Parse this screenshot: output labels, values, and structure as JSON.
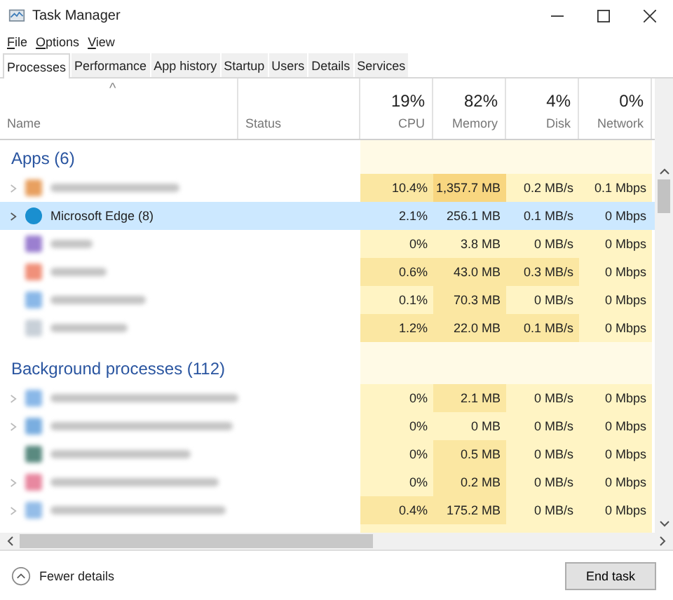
{
  "window": {
    "title": "Task Manager"
  },
  "menu": [
    "File",
    "Options",
    "View"
  ],
  "tabs": [
    {
      "label": "Processes",
      "selected": true
    },
    {
      "label": "Performance",
      "selected": false
    },
    {
      "label": "App history",
      "selected": false
    },
    {
      "label": "Startup",
      "selected": false
    },
    {
      "label": "Users",
      "selected": false
    },
    {
      "label": "Details",
      "selected": false
    },
    {
      "label": "Services",
      "selected": false
    }
  ],
  "table": {
    "sort_caret": "^",
    "columns": [
      {
        "label": "Name"
      },
      {
        "label": "Status"
      },
      {
        "label": "CPU",
        "total": "19%"
      },
      {
        "label": "Memory",
        "total": "82%"
      },
      {
        "label": "Disk",
        "total": "4%"
      },
      {
        "label": "Network",
        "total": "0%"
      }
    ],
    "groups": [
      {
        "title": "Apps (6)",
        "rows": [
          {
            "blurred": true,
            "expandable": true,
            "selected": false,
            "color": "#e8a060",
            "cells": [
              {
                "text": "10.4%",
                "color": "#fbe7a2"
              },
              {
                "text": "1,357.7 MB",
                "color": "#f8d680"
              },
              {
                "text": "0.2 MB/s",
                "color": "#fff4c4"
              },
              {
                "text": "0.1 Mbps",
                "color": "#fff4c4"
              }
            ]
          },
          {
            "blurred": false,
            "name": "Microsoft Edge (8)",
            "expandable": true,
            "selected": true,
            "color": "#1a8fd0",
            "cells": [
              {
                "text": "2.1%",
                "color": "#cce8ff"
              },
              {
                "text": "256.1 MB",
                "color": "#cce8ff"
              },
              {
                "text": "0.1 MB/s",
                "color": "#cce8ff"
              },
              {
                "text": "0 Mbps",
                "color": "#cce8ff"
              }
            ]
          },
          {
            "blurred": true,
            "expandable": false,
            "selected": false,
            "color": "#9b7fd0",
            "cells": [
              {
                "text": "0%",
                "color": "#fff4c4"
              },
              {
                "text": "3.8 MB",
                "color": "#fff4c4"
              },
              {
                "text": "0 MB/s",
                "color": "#fff4c4"
              },
              {
                "text": "0 Mbps",
                "color": "#fff4c4"
              }
            ]
          },
          {
            "blurred": true,
            "expandable": false,
            "selected": false,
            "color": "#f0907a",
            "cells": [
              {
                "text": "0.6%",
                "color": "#fbe7a2"
              },
              {
                "text": "43.0 MB",
                "color": "#fbe7a2"
              },
              {
                "text": "0.3 MB/s",
                "color": "#fbe7a2"
              },
              {
                "text": "0 Mbps",
                "color": "#fff4c4"
              }
            ]
          },
          {
            "blurred": true,
            "expandable": false,
            "selected": false,
            "color": "#8ab8e8",
            "cells": [
              {
                "text": "0.1%",
                "color": "#fff4c4"
              },
              {
                "text": "70.3 MB",
                "color": "#fbe7a2"
              },
              {
                "text": "0 MB/s",
                "color": "#fff4c4"
              },
              {
                "text": "0 Mbps",
                "color": "#fff4c4"
              }
            ]
          },
          {
            "blurred": true,
            "expandable": false,
            "selected": false,
            "color": "#c8d0d8",
            "cells": [
              {
                "text": "1.2%",
                "color": "#fbe7a2"
              },
              {
                "text": "22.0 MB",
                "color": "#fbe7a2"
              },
              {
                "text": "0.1 MB/s",
                "color": "#fbe7a2"
              },
              {
                "text": "0 Mbps",
                "color": "#fff4c4"
              }
            ]
          }
        ]
      },
      {
        "title": "Background processes (112)",
        "rows": [
          {
            "blurred": true,
            "expandable": true,
            "selected": false,
            "color": "#8ab8e8",
            "cells": [
              {
                "text": "0%",
                "color": "#fff4c4"
              },
              {
                "text": "2.1 MB",
                "color": "#fbe7a2"
              },
              {
                "text": "0 MB/s",
                "color": "#fff4c4"
              },
              {
                "text": "0 Mbps",
                "color": "#fff4c4"
              }
            ]
          },
          {
            "blurred": true,
            "expandable": true,
            "selected": false,
            "color": "#7aaee0",
            "cells": [
              {
                "text": "0%",
                "color": "#fff4c4"
              },
              {
                "text": "0 MB",
                "color": "#fff4c4"
              },
              {
                "text": "0 MB/s",
                "color": "#fff4c4"
              },
              {
                "text": "0 Mbps",
                "color": "#fff4c4"
              }
            ]
          },
          {
            "blurred": true,
            "expandable": false,
            "selected": false,
            "color": "#5a8a80",
            "cells": [
              {
                "text": "0%",
                "color": "#fff4c4"
              },
              {
                "text": "0.5 MB",
                "color": "#fbe7a2"
              },
              {
                "text": "0 MB/s",
                "color": "#fff4c4"
              },
              {
                "text": "0 Mbps",
                "color": "#fff4c4"
              }
            ]
          },
          {
            "blurred": true,
            "expandable": true,
            "selected": false,
            "color": "#e888a0",
            "cells": [
              {
                "text": "0%",
                "color": "#fff4c4"
              },
              {
                "text": "0.2 MB",
                "color": "#fbe7a2"
              },
              {
                "text": "0 MB/s",
                "color": "#fff4c4"
              },
              {
                "text": "0 Mbps",
                "color": "#fff4c4"
              }
            ]
          },
          {
            "blurred": true,
            "expandable": true,
            "selected": false,
            "color": "#94bde8",
            "cells": [
              {
                "text": "0.4%",
                "color": "#fbe7a2"
              },
              {
                "text": "175.2 MB",
                "color": "#fbe7a2"
              },
              {
                "text": "0 MB/s",
                "color": "#fff4c4"
              },
              {
                "text": "0 Mbps",
                "color": "#fff4c4"
              }
            ]
          }
        ]
      }
    ]
  },
  "footer": {
    "toggle": "Fewer details",
    "button": "End task"
  }
}
